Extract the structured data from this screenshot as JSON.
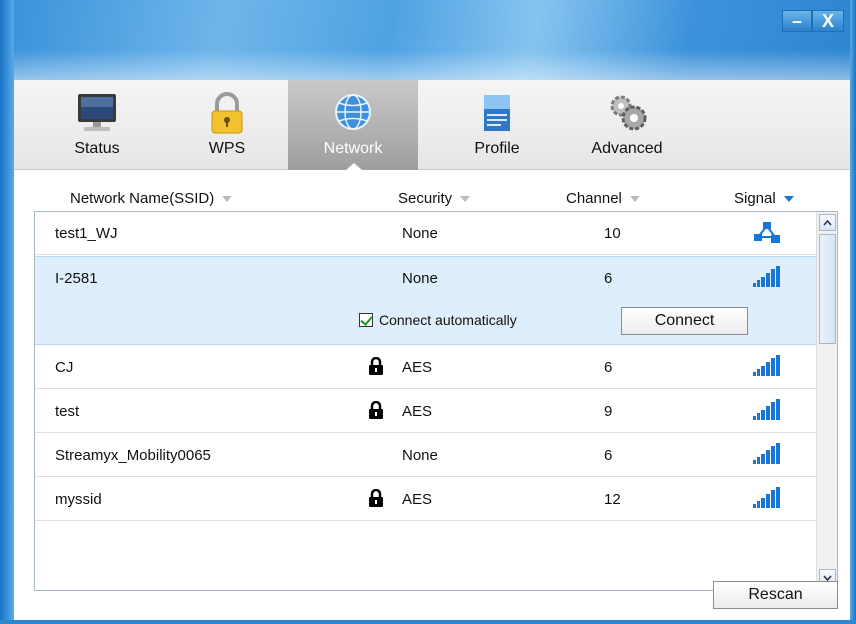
{
  "window": {
    "controls": {
      "minimize": "–",
      "close": "X"
    }
  },
  "toolbar": {
    "tabs": [
      {
        "label": "Status",
        "icon": "monitor-icon",
        "active": false
      },
      {
        "label": "WPS",
        "icon": "padlock-icon",
        "active": false
      },
      {
        "label": "Network",
        "icon": "globe-icon",
        "active": true
      },
      {
        "label": "Profile",
        "icon": "document-icon",
        "active": false
      },
      {
        "label": "Advanced",
        "icon": "gears-icon",
        "active": false
      }
    ]
  },
  "columns": {
    "ssid": "Network Name(SSID)",
    "security": "Security",
    "channel": "Channel",
    "signal": "Signal",
    "sorted_by": "signal"
  },
  "networks": [
    {
      "ssid": "test1_WJ",
      "security": "None",
      "locked": false,
      "channel": "10",
      "signal_icon": "adhoc-network-icon"
    },
    {
      "ssid": "I-2581",
      "security": "None",
      "locked": false,
      "channel": "6",
      "signal_icon": "signal-bars-icon"
    },
    {
      "ssid": "CJ",
      "security": "AES",
      "locked": true,
      "channel": "6",
      "signal_icon": "signal-bars-icon"
    },
    {
      "ssid": "test",
      "security": "AES",
      "locked": true,
      "channel": "9",
      "signal_icon": "signal-bars-icon"
    },
    {
      "ssid": "Streamyx_Mobility0065",
      "security": "None",
      "locked": false,
      "channel": "6",
      "signal_icon": "signal-bars-icon"
    },
    {
      "ssid": "myssid",
      "security": "AES",
      "locked": true,
      "channel": "12",
      "signal_icon": "signal-bars-icon"
    }
  ],
  "selected": {
    "auto_connect_label": "Connect automatically",
    "auto_connect_checked": true,
    "connect_label": "Connect"
  },
  "actions": {
    "rescan_label": "Rescan"
  },
  "colors": {
    "accent": "#1877d6",
    "selected_row": "#dfeefc",
    "signal": "#1877d6"
  }
}
